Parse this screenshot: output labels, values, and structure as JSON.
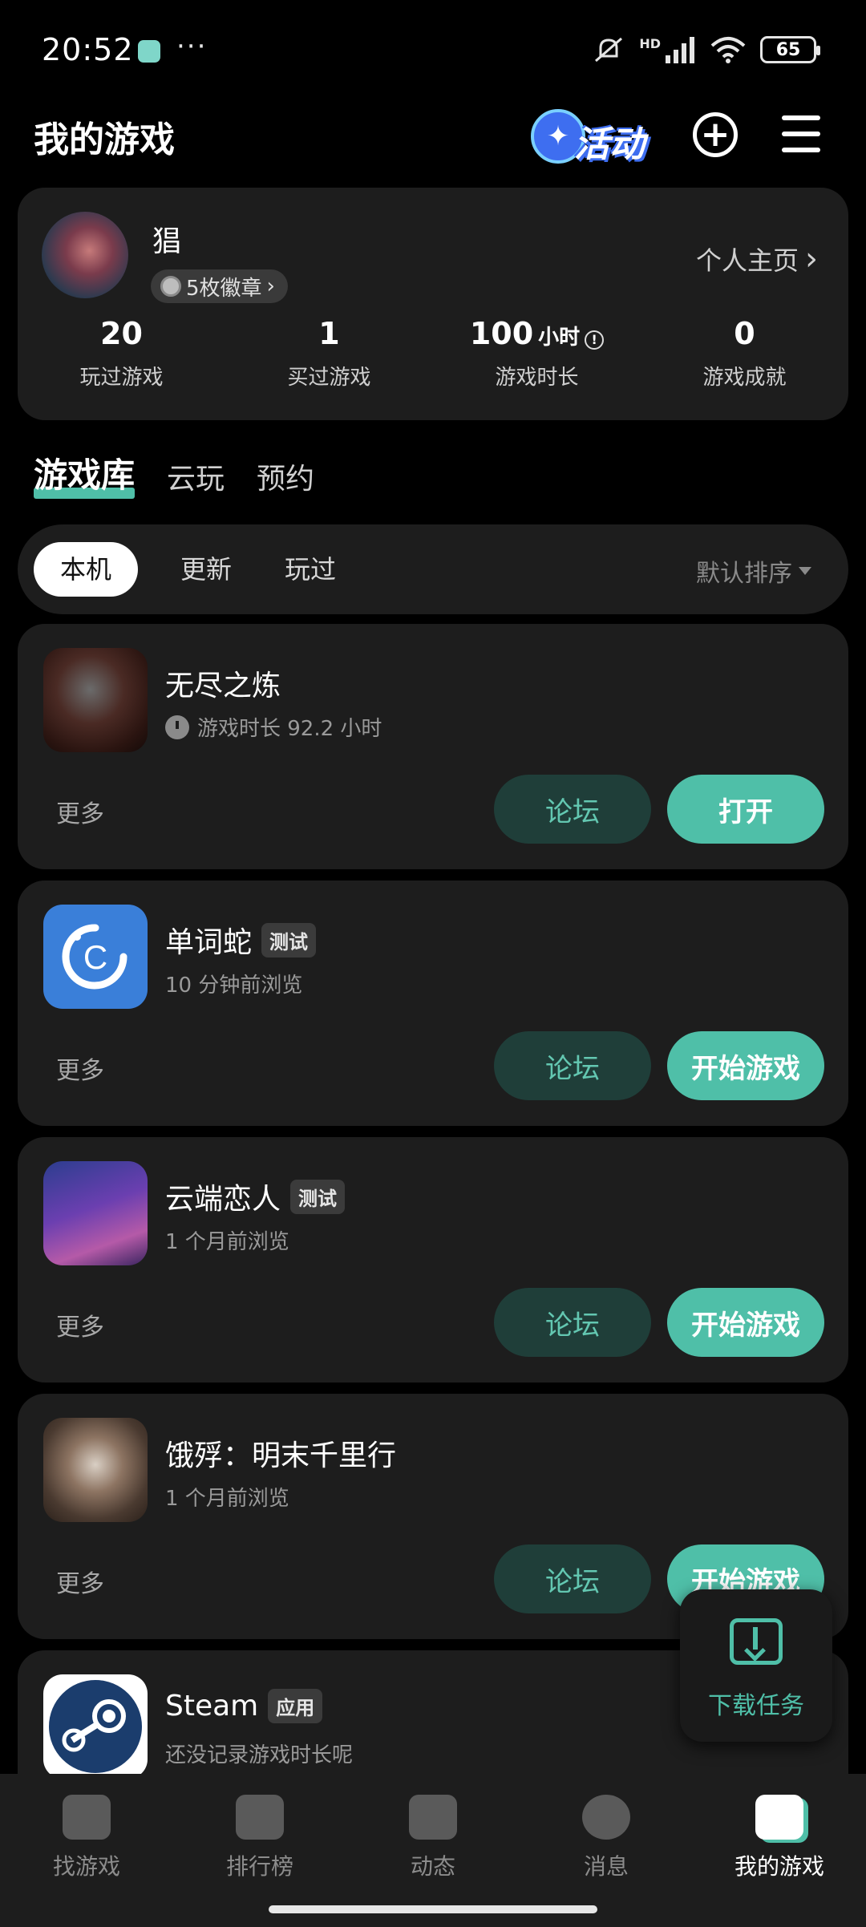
{
  "status_bar": {
    "time": "20:52",
    "dots": "···",
    "hd": "HD",
    "battery": "65"
  },
  "header": {
    "title": "我的游戏",
    "event_label": "活动",
    "add_symbol": "+"
  },
  "profile": {
    "username": "猖",
    "badges": "5枚徽章",
    "profile_link": "个人主页",
    "stats": [
      {
        "value": "20",
        "unit": "",
        "label": "玩过游戏"
      },
      {
        "value": "1",
        "unit": "",
        "label": "买过游戏"
      },
      {
        "value": "100",
        "unit": "小时",
        "label": "游戏时长"
      },
      {
        "value": "0",
        "unit": "",
        "label": "游戏成就"
      }
    ]
  },
  "main_tabs": [
    "游戏库",
    "云玩",
    "预约"
  ],
  "filters": {
    "chips": [
      "本机",
      "更新",
      "玩过"
    ],
    "sort": "默认排序"
  },
  "games": [
    {
      "name": "无尽之炼",
      "tag": "",
      "sub": "游戏时长 92.2 小时",
      "more": "更多",
      "forum": "论坛",
      "action": "打开"
    },
    {
      "name": "单词蛇",
      "tag": "测试",
      "sub": "10 分钟前浏览",
      "more": "更多",
      "forum": "论坛",
      "action": "开始游戏"
    },
    {
      "name": "云端恋人",
      "tag": "测试",
      "sub": "1 个月前浏览",
      "more": "更多",
      "forum": "论坛",
      "action": "开始游戏"
    },
    {
      "name": "饿殍：明末千里行",
      "tag": "",
      "sub": "1 个月前浏览",
      "more": "更多",
      "forum": "论坛",
      "action": "开始游戏"
    },
    {
      "name": "Steam",
      "tag": "应用",
      "sub": "还没记录游戏时长呢",
      "more": "",
      "forum": "",
      "action": ""
    }
  ],
  "download_fab": {
    "label": "下载任务"
  },
  "bottom_nav": [
    {
      "label": "找游戏",
      "icon": "find-games-icon"
    },
    {
      "label": "排行榜",
      "icon": "ranking-icon"
    },
    {
      "label": "动态",
      "icon": "feed-icon"
    },
    {
      "label": "消息",
      "icon": "message-icon"
    },
    {
      "label": "我的游戏",
      "icon": "my-games-icon"
    }
  ],
  "colors": {
    "accent": "#4fbfa8",
    "card": "#1d1d1d",
    "background": "#000000"
  }
}
